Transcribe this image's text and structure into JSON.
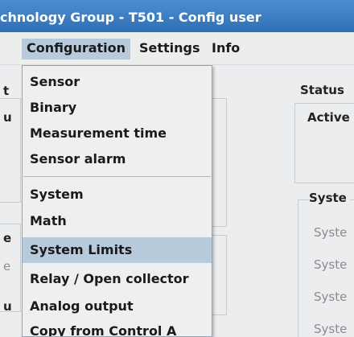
{
  "window": {
    "title": "chnology Group - T501 - Config user"
  },
  "menubar": {
    "items": [
      {
        "label": "Configuration"
      },
      {
        "label": "Settings"
      },
      {
        "label": "Info"
      }
    ]
  },
  "dropdown": {
    "items": [
      {
        "label": "Sensor"
      },
      {
        "label": "Binary"
      },
      {
        "label": "Measurement time"
      },
      {
        "label": "Sensor alarm"
      },
      {
        "label": "System"
      },
      {
        "label": "Math"
      },
      {
        "label": "System Limits"
      },
      {
        "label": "Relay / Open collector"
      },
      {
        "label": "Analog output"
      },
      {
        "label": "Copy from Control A"
      }
    ],
    "highlighted": "System Limits"
  },
  "background": {
    "status_label": "Status",
    "active_label": "Active",
    "system_label": "Syste",
    "system_rows": [
      "Syste",
      "Syste",
      "Syste",
      "Syste"
    ],
    "left_fragments": [
      "t",
      "u",
      "e",
      "e",
      "u"
    ]
  },
  "colors": {
    "titlebar": "#3f80c4",
    "menu_highlight": "#b7cbdc",
    "background": "#ecedef"
  }
}
